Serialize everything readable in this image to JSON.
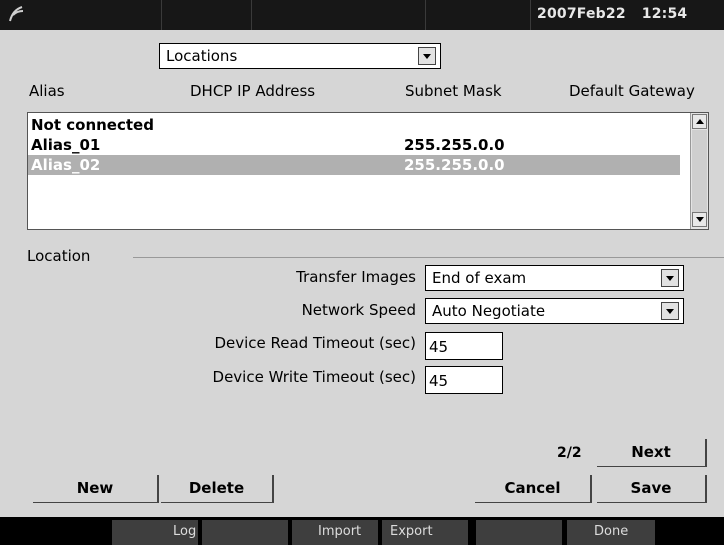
{
  "topbar": {
    "date": "2007Feb22",
    "time": "12:54"
  },
  "locations_select": {
    "value": "Locations"
  },
  "columns": [
    "Alias",
    "DHCP IP Address",
    "Subnet Mask",
    "Default Gateway"
  ],
  "list": {
    "rows": [
      {
        "alias": "Not connected",
        "subnet": ""
      },
      {
        "alias": "Alias_01",
        "subnet": "255.255.0.0"
      },
      {
        "alias": "Alias_02",
        "subnet": "255.255.0.0"
      }
    ]
  },
  "location": {
    "section_label": "Location",
    "transfer_images_label": "Transfer Images",
    "transfer_images_value": "End of exam",
    "network_speed_label": "Network Speed",
    "network_speed_value": "Auto Negotiate",
    "read_timeout_label": "Device Read Timeout (sec)",
    "read_timeout_value": "45",
    "write_timeout_label": "Device Write Timeout (sec)",
    "write_timeout_value": "45"
  },
  "pagination": {
    "page": "2/2",
    "next_label": "Next"
  },
  "buttons": {
    "new": "New",
    "delete": "Delete",
    "cancel": "Cancel",
    "save": "Save"
  },
  "softkeys": [
    "Log",
    "",
    "Import",
    "Export",
    "",
    "Done"
  ]
}
